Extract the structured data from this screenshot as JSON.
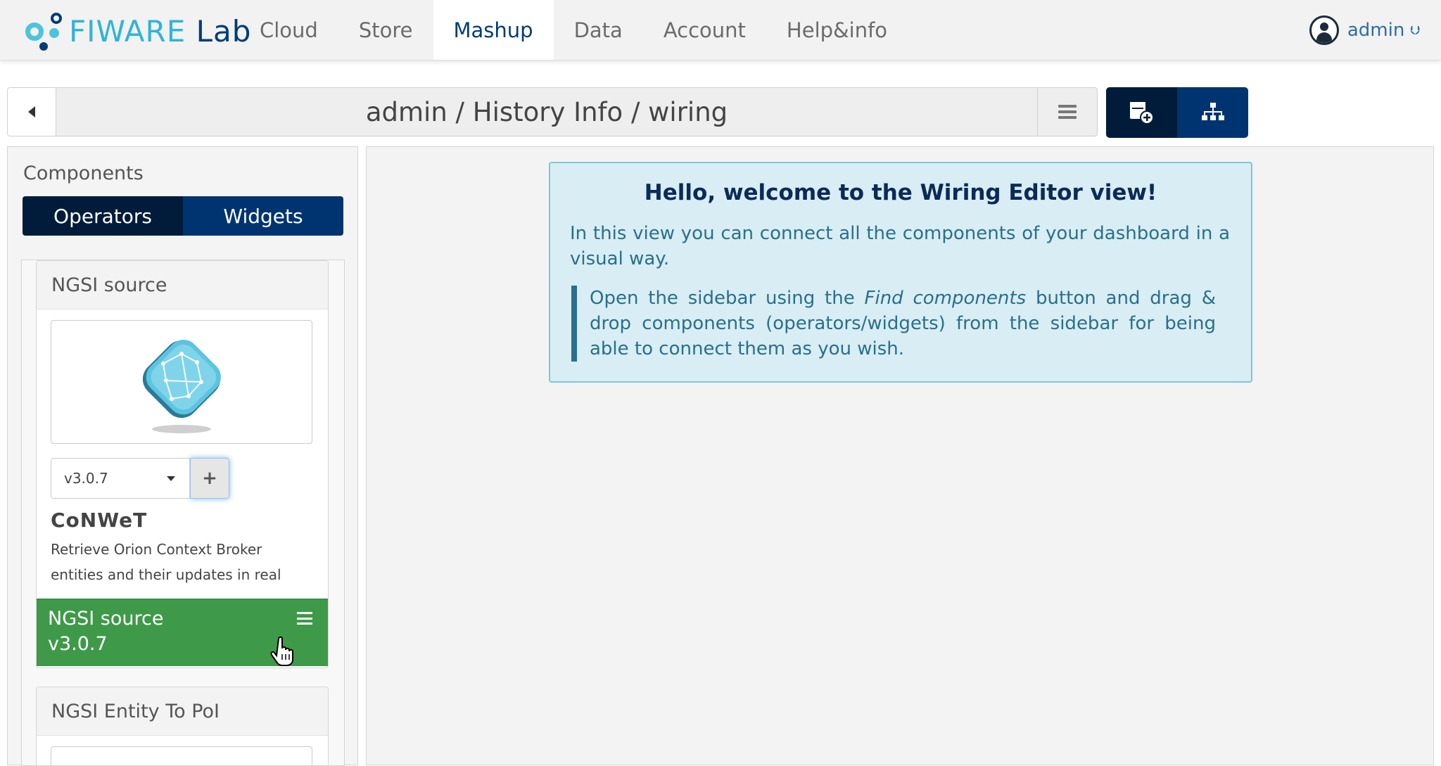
{
  "brand": {
    "logo_main": "FIWARE",
    "logo_sub": "Lab"
  },
  "nav": {
    "items": [
      {
        "label": "Cloud"
      },
      {
        "label": "Store"
      },
      {
        "label": "Mashup"
      },
      {
        "label": "Data"
      },
      {
        "label": "Account"
      },
      {
        "label": "Help&info"
      }
    ],
    "active": "Mashup"
  },
  "user": {
    "name": "admin",
    "icon": "user-circle-icon"
  },
  "breadcrumb": {
    "text": "admin / History Info / wiring"
  },
  "toolbar": {
    "find_components_icon": "add-component-icon",
    "behaviour_icon": "sitemap-icon"
  },
  "sidebar": {
    "title": "Components",
    "tabs": [
      {
        "label": "Operators"
      },
      {
        "label": "Widgets"
      }
    ],
    "active_tab": "Operators",
    "components": [
      {
        "name": "NGSI source",
        "version": "v3.0.7",
        "vendor": "CoNWeT",
        "description": "Retrieve Orion Context Broker entities and their updates in real",
        "drag_label_name": "NGSI source",
        "drag_label_version": "v3.0.7"
      },
      {
        "name": "NGSI Entity To PoI"
      }
    ]
  },
  "welcome": {
    "title": "Hello, welcome to the Wiring Editor view!",
    "intro": "In this view you can connect all the components of your dashboard in a visual way.",
    "tip_before": "Open the sidebar using the ",
    "tip_emphasis": "Find components",
    "tip_after": " button and drag & drop components (operators/widgets) from the sidebar for being able to connect them as you wish."
  },
  "colors": {
    "accent_dark": "#001c3a",
    "accent": "#003470",
    "drag_green": "#3e9a48",
    "info_bg": "#d8edf4",
    "info_text": "#2a6f8c"
  }
}
